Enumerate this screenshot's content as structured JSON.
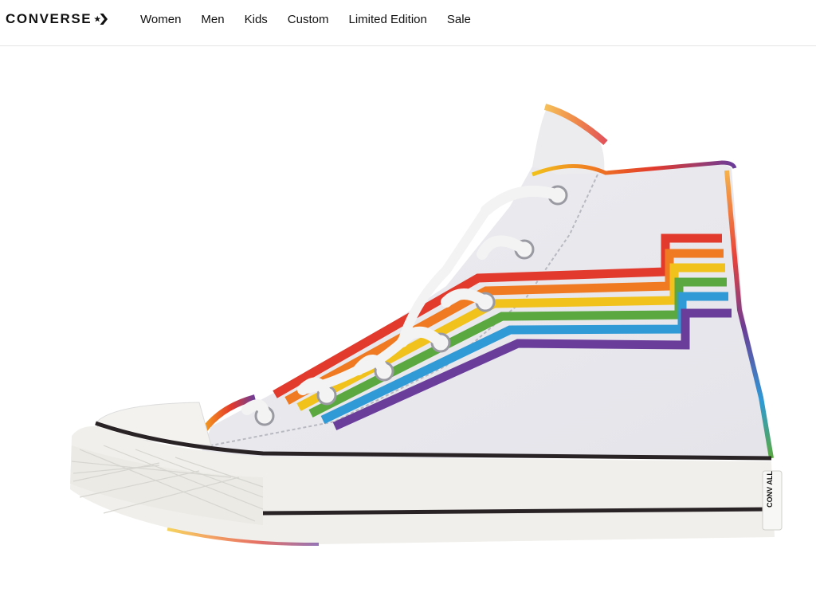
{
  "header": {
    "brand": "CONVERSE",
    "brand_icon": "star-chevron-logo-icon",
    "nav": [
      {
        "label": "Women"
      },
      {
        "label": "Men"
      },
      {
        "label": "Kids"
      },
      {
        "label": "Custom"
      },
      {
        "label": "Limited Edition"
      },
      {
        "label": "Sale"
      }
    ]
  },
  "product": {
    "image_subject": "white high-top sneaker with rainbow stripes",
    "heel_label": "CONV ALL",
    "stripe_colors": [
      "#e23a2c",
      "#f07a22",
      "#f1c21b",
      "#5aa83f",
      "#2f9ad6",
      "#6a3d9a"
    ]
  }
}
